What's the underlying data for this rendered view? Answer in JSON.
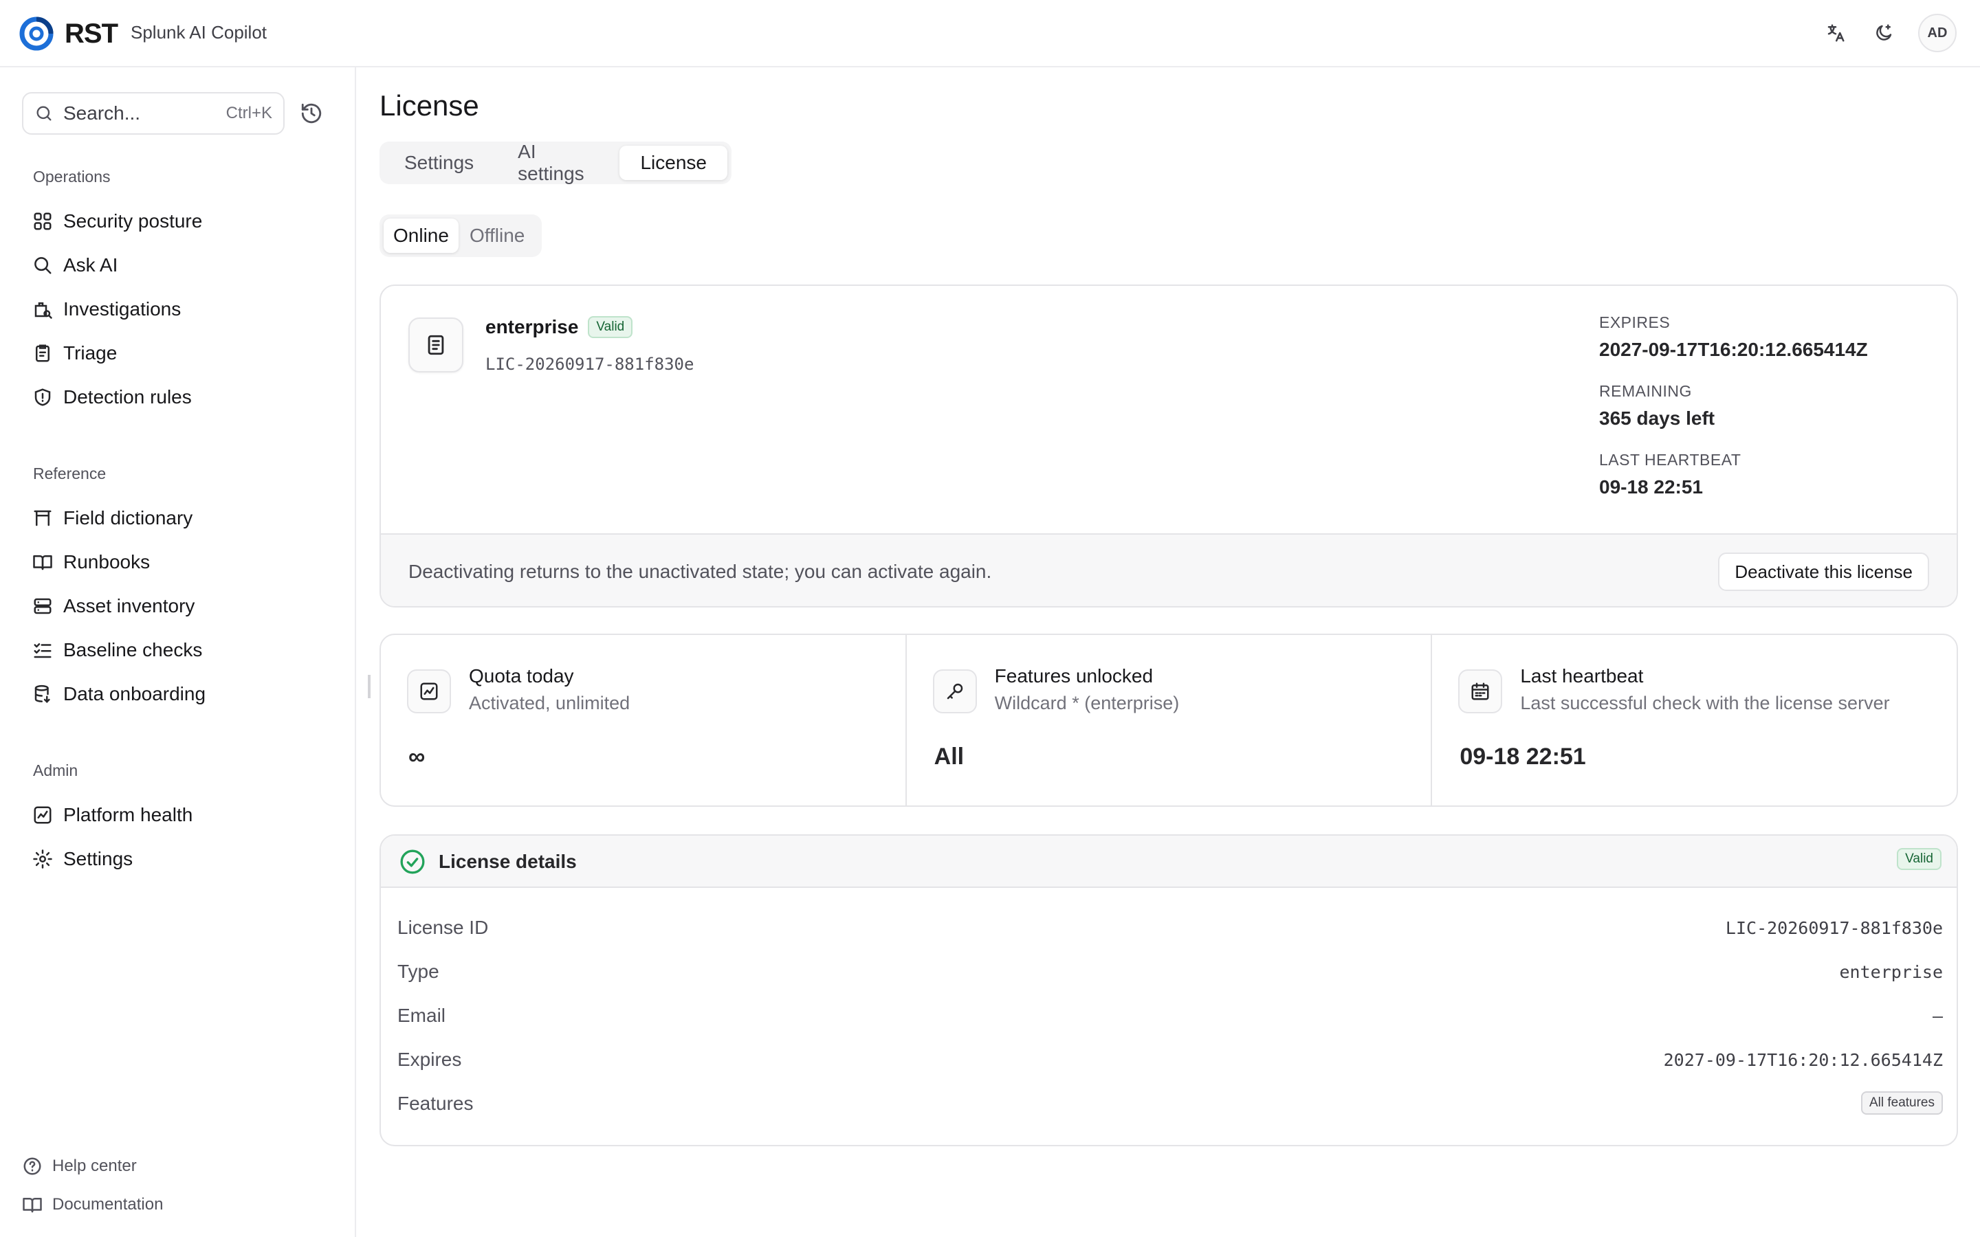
{
  "app": {
    "brand": "RST",
    "name": "Splunk AI Copilot",
    "user_initials": "AD"
  },
  "search": {
    "placeholder": "Search...",
    "shortcut": "Ctrl+K"
  },
  "sidebar": {
    "sections": [
      {
        "label": "Operations",
        "items": [
          {
            "label": "Security posture",
            "icon": "grid-icon"
          },
          {
            "label": "Ask AI",
            "icon": "search-icon"
          },
          {
            "label": "Investigations",
            "icon": "case-icon"
          },
          {
            "label": "Triage",
            "icon": "clipboard-icon"
          },
          {
            "label": "Detection rules",
            "icon": "shield-icon"
          }
        ]
      },
      {
        "label": "Reference",
        "items": [
          {
            "label": "Field dictionary",
            "icon": "table-icon"
          },
          {
            "label": "Runbooks",
            "icon": "book-icon"
          },
          {
            "label": "Asset inventory",
            "icon": "server-icon"
          },
          {
            "label": "Baseline checks",
            "icon": "checklist-icon"
          },
          {
            "label": "Data onboarding",
            "icon": "database-icon"
          }
        ]
      },
      {
        "label": "Admin",
        "items": [
          {
            "label": "Platform health",
            "icon": "activity-icon"
          },
          {
            "label": "Settings",
            "icon": "gear-icon"
          }
        ]
      }
    ],
    "footer": [
      {
        "label": "Help center",
        "icon": "help-icon"
      },
      {
        "label": "Documentation",
        "icon": "book-icon"
      }
    ]
  },
  "page": {
    "title": "License",
    "tabs": [
      "Settings",
      "AI settings",
      "License"
    ],
    "active_tab": "License",
    "modes": [
      "Online",
      "Offline"
    ],
    "active_mode": "Online"
  },
  "license": {
    "type": "enterprise",
    "status": "Valid",
    "id": "LIC-20260917-881f830e",
    "expires_label": "EXPIRES",
    "expires": "2027-09-17T16:20:12.665414Z",
    "remaining_label": "REMAINING",
    "remaining": "365 days left",
    "heartbeat_label": "LAST HEARTBEAT",
    "heartbeat": "09-18 22:51",
    "footer_message": "Deactivating returns to the unactivated state; you can activate again.",
    "deactivate_label": "Deactivate this license"
  },
  "stats": [
    {
      "title": "Quota today",
      "subtitle": "Activated, unlimited",
      "value": "∞",
      "icon": "chart-icon"
    },
    {
      "title": "Features unlocked",
      "subtitle": "Wildcard * (enterprise)",
      "value": "All",
      "icon": "key-icon"
    },
    {
      "title": "Last heartbeat",
      "subtitle": "Last successful check with the license server",
      "value": "09-18 22:51",
      "icon": "calendar-icon"
    }
  ],
  "details": {
    "title": "License details",
    "status": "Valid",
    "rows": [
      {
        "key": "License ID",
        "value": "LIC-20260917-881f830e"
      },
      {
        "key": "Type",
        "value": "enterprise"
      },
      {
        "key": "Email",
        "value": "—"
      },
      {
        "key": "Expires",
        "value": "2027-09-17T16:20:12.665414Z"
      },
      {
        "key": "Features",
        "value": "All features"
      }
    ]
  },
  "colors": {
    "accent": "#1d6fd8",
    "valid_green": "#22a35a",
    "border": "#e4e4e7"
  }
}
